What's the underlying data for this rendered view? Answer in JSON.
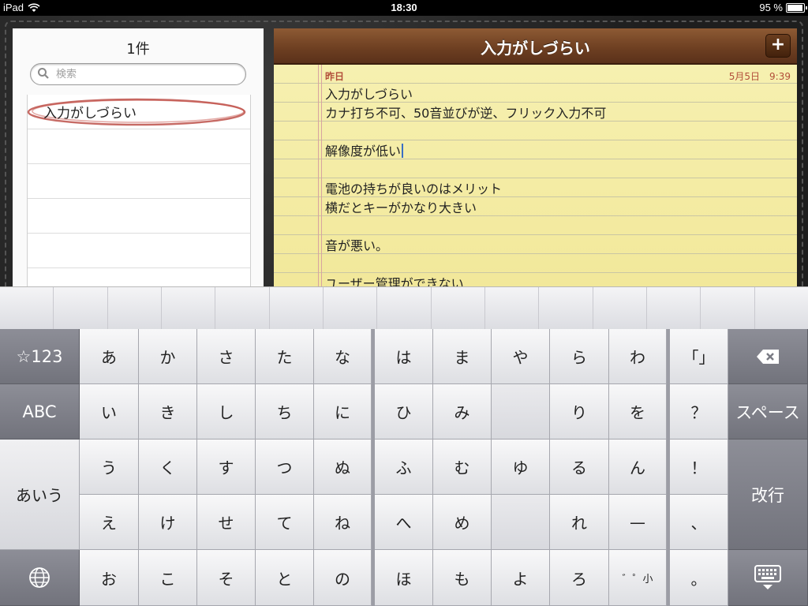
{
  "status": {
    "device": "iPad",
    "time": "18:30",
    "battery": "95 %",
    "battery_level": 0.95
  },
  "list": {
    "count_label": "1件",
    "search_placeholder": "検索",
    "items": [
      {
        "label": "入力がしづらい"
      }
    ]
  },
  "note": {
    "title": "入力がしづらい",
    "add_label": "+",
    "date_label": "昨日",
    "datetime": "5月5日　9:39",
    "lines": [
      "入力がしづらい",
      "カナ打ち不可、50音並びが逆、フリック入力不可",
      "",
      "解像度が低い",
      "",
      "電池の持ちが良いのはメリット",
      "横だとキーがかなり大きい",
      "",
      "音が悪い。",
      "",
      "ユーザー管理ができない"
    ]
  },
  "keyboard": {
    "left": {
      "mode_symbols": "☆123",
      "mode_abc": "ABC",
      "mode_kana": "あいう",
      "globe_icon": "globe-icon"
    },
    "rows": [
      [
        "あ",
        "か",
        "さ",
        "た",
        "な",
        "は",
        "ま",
        "や",
        "ら",
        "わ",
        "「」"
      ],
      [
        "い",
        "き",
        "し",
        "ち",
        "に",
        "ひ",
        "み",
        "",
        "り",
        "を",
        "？"
      ],
      [
        "う",
        "く",
        "す",
        "つ",
        "ぬ",
        "ふ",
        "む",
        "ゆ",
        "る",
        "ん",
        "！"
      ],
      [
        "え",
        "け",
        "せ",
        "て",
        "ね",
        "へ",
        "め",
        "",
        "れ",
        "—",
        "、"
      ],
      [
        "お",
        "こ",
        "そ",
        "と",
        "の",
        "ほ",
        "も",
        "よ",
        "ろ",
        "゛゜小",
        "。"
      ]
    ],
    "right": {
      "delete_icon": "backspace-icon",
      "space": "スペース",
      "return": "改行",
      "hide_icon": "keyboard-hide-icon"
    }
  }
}
